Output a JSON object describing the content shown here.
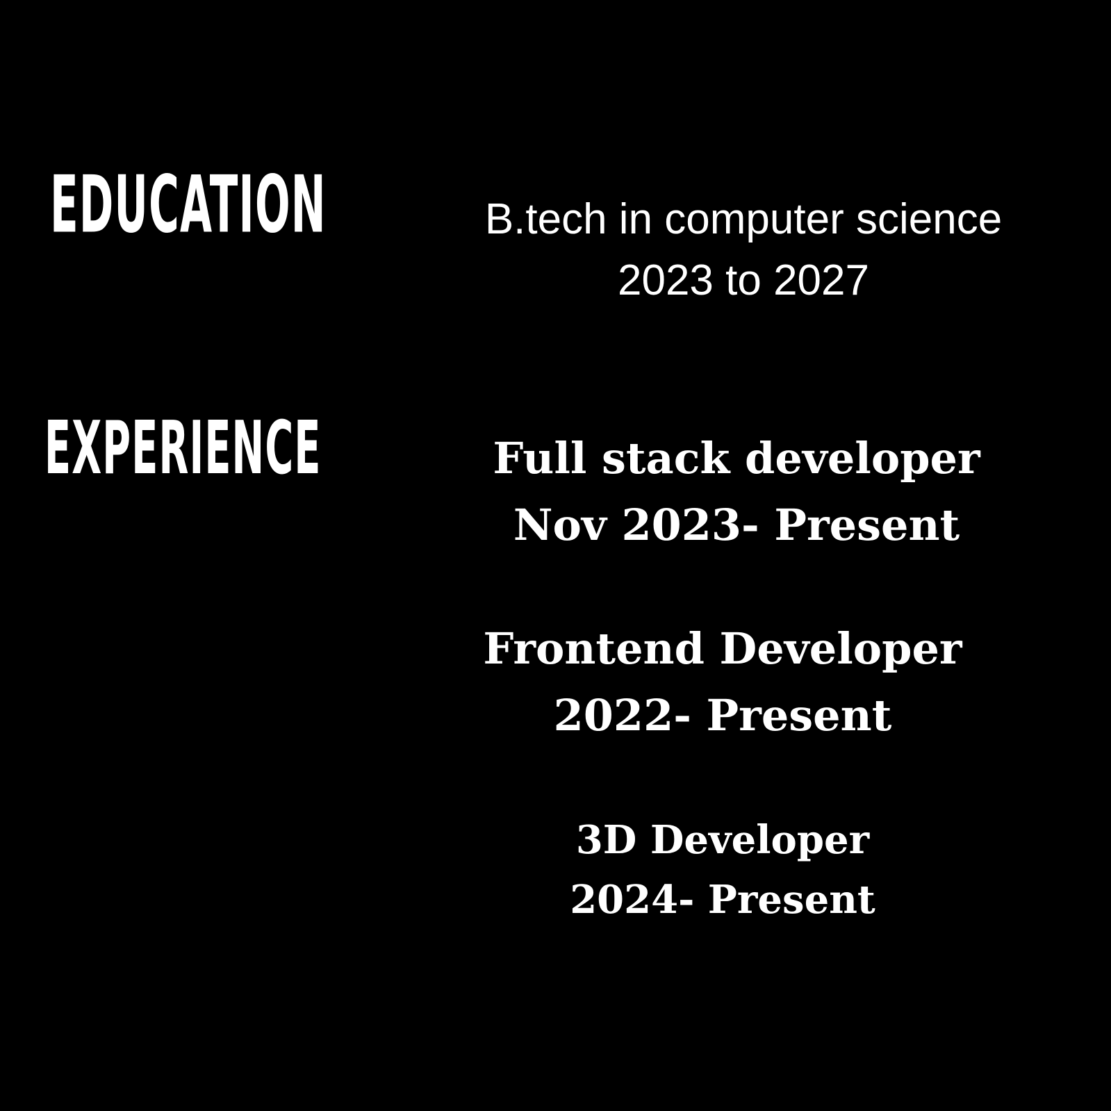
{
  "education": {
    "heading": "EDUCATION",
    "degree": "B.tech in computer science",
    "period": "2023 to 2027"
  },
  "experience": {
    "heading": "EXPERIENCE",
    "items": [
      {
        "role": "Full stack developer",
        "period": "Nov 2023- Present"
      },
      {
        "role": "Frontend Developer",
        "period": "2022- Present"
      },
      {
        "role": "3D Developer",
        "period": "2024- Present"
      }
    ]
  },
  "colors": {
    "background": "#000000",
    "text": "#ffffff"
  }
}
